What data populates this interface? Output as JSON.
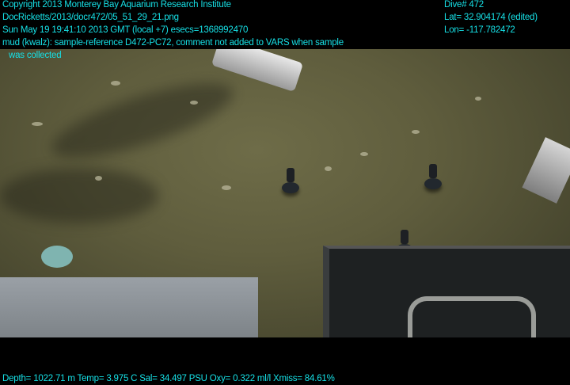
{
  "overlay_top_left": {
    "copyright": "Copyright 2013 Monterey Bay Aquarium Research Institute",
    "file_path": "DocRicketts/2013/docr472/05_51_29_21.png",
    "timestamp": "Sun May 19 19:41:10 2013 GMT (local +7)  esecs=1368992470",
    "comment_line1": "mud (kwalz): sample-reference D472-PC72, comment not added to VARS when sample",
    "comment_line2": "was collected"
  },
  "overlay_top_right": {
    "dive": "Dive# 472",
    "lat": "Lat= 32.904174 (edited)",
    "lon": "Lon= -117.782472"
  },
  "overlay_bottom": {
    "telemetry": "Depth= 1022.71 m  Temp= 3.975 C  Sal= 34.497 PSU  Oxy= 0.322 ml/l  Xmiss= 84.61%"
  },
  "colors": {
    "overlay_text": "#16e0e6"
  }
}
